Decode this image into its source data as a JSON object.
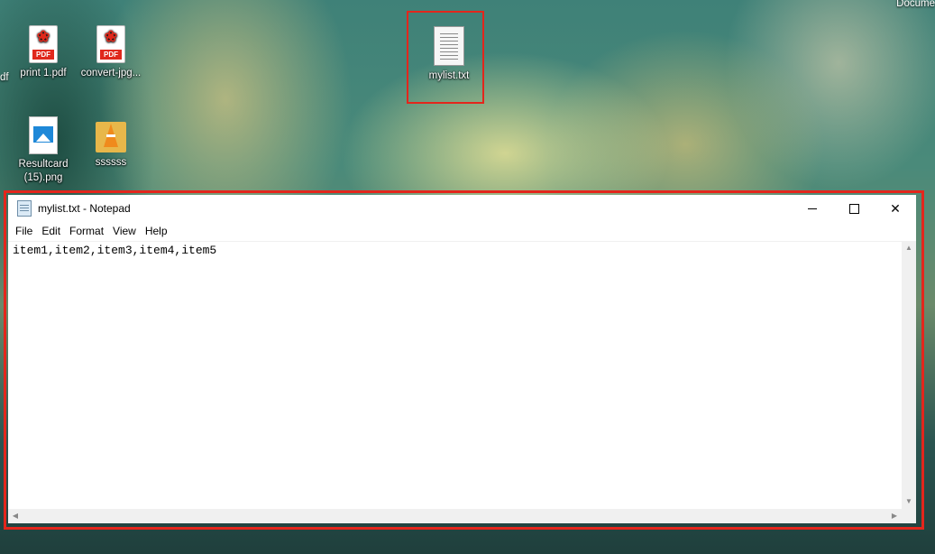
{
  "desktop": {
    "top_right_label": "Docume",
    "left_fragment": "df",
    "icons": [
      {
        "label": "print 1.pdf",
        "badge": "PDF"
      },
      {
        "label": "convert-jpg...",
        "badge": "PDF"
      },
      {
        "label": "Resultcard (15).png"
      },
      {
        "label": "ssssss"
      },
      {
        "label": "mylist.txt"
      }
    ]
  },
  "window": {
    "title": "mylist.txt - Notepad",
    "menu": [
      "File",
      "Edit",
      "Format",
      "View",
      "Help"
    ],
    "content": "item1,item2,item3,item4,item5"
  },
  "colors": {
    "highlight": "#e3261c",
    "pdf_red": "#e0281c"
  }
}
